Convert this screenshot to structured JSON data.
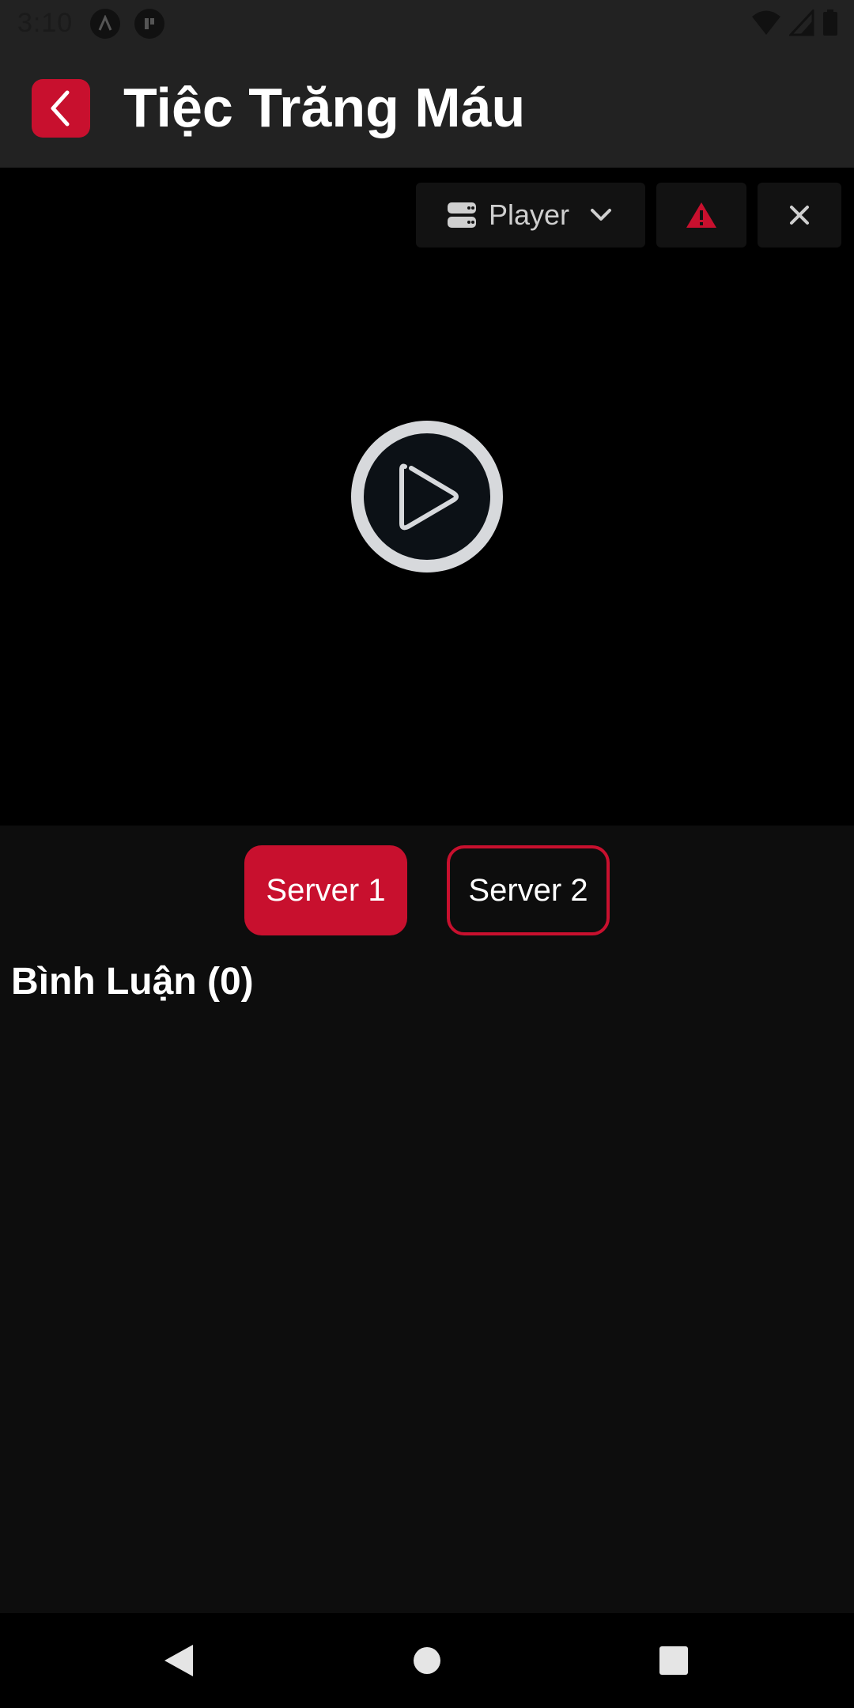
{
  "status_bar": {
    "time": "3:10"
  },
  "header": {
    "title": "Tiệc Trăng Máu",
    "back_icon": "chevron-left-icon"
  },
  "player": {
    "selector_label": "Player",
    "selector_icon": "server-icon",
    "report_icon": "warning-icon",
    "close_icon": "close-icon",
    "play_icon": "play-icon"
  },
  "servers": [
    {
      "label": "Server 1",
      "active": true
    },
    {
      "label": "Server 2",
      "active": false
    }
  ],
  "comments": {
    "heading": "Bình Luận (0)"
  },
  "colors": {
    "accent": "#c8102e",
    "header_bg": "#222222",
    "page_bg": "#0d0d0d",
    "player_bg": "#000000"
  }
}
